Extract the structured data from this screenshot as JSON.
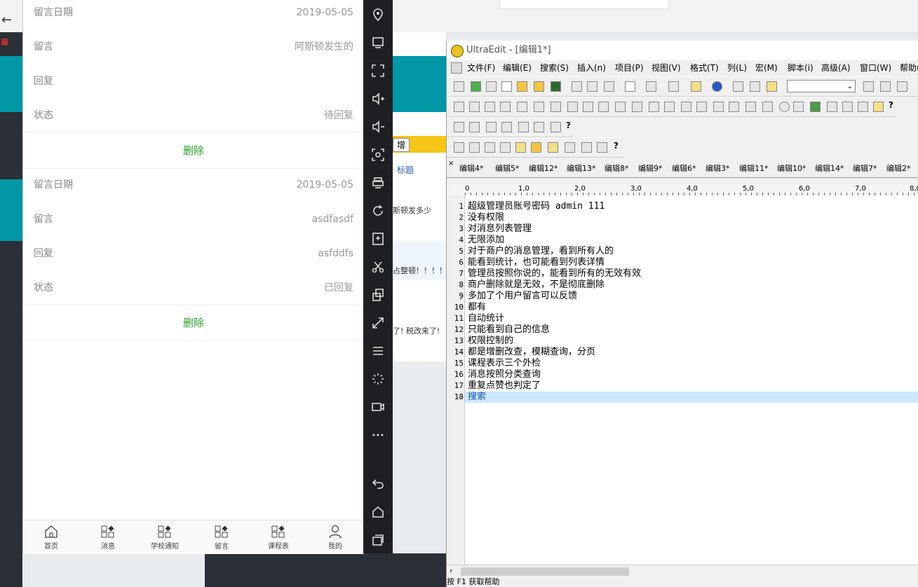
{
  "phone": {
    "cards": [
      {
        "rows": [
          {
            "label": "留言日期",
            "value": "2019-05-05"
          },
          {
            "label": "留言",
            "value": "阿斯顿发生的"
          },
          {
            "label": "回复",
            "value": ""
          },
          {
            "label": "状态",
            "value": "待回复"
          }
        ],
        "delete_label": "删除"
      },
      {
        "rows": [
          {
            "label": "留言日期",
            "value": "2019-05-05"
          },
          {
            "label": "留言",
            "value": "asdfasdf"
          },
          {
            "label": "回复",
            "value": "asfddfs"
          },
          {
            "label": "状态",
            "value": "已回复"
          }
        ],
        "delete_label": "删除"
      }
    ],
    "tabbar": [
      {
        "label": "首页",
        "icon": "home-icon"
      },
      {
        "label": "消息",
        "icon": "grid-icon"
      },
      {
        "label": "学校通知",
        "icon": "grid-icon"
      },
      {
        "label": "留言",
        "icon": "grid-icon"
      },
      {
        "label": "课程表",
        "icon": "grid-icon"
      },
      {
        "label": "我的",
        "icon": "user-icon"
      }
    ]
  },
  "background_page": {
    "add_button": "增",
    "column_header": "标题",
    "row_texts": [
      "斯顿发多少",
      "占整顿！！！！",
      "了! 税改来了!"
    ]
  },
  "emulator_sidebar": {
    "icons": [
      "location-icon",
      "screen-icon",
      "fullscreen-icon",
      "volume-up-icon",
      "volume-down-icon",
      "screenshot-icon",
      "printer-icon",
      "rotate-icon",
      "apk-install-icon",
      "scissors-icon",
      "multi-window-icon",
      "resize-icon",
      "menu-icon",
      "loading-icon",
      "video-icon",
      "more-icon",
      "back-icon",
      "home-icon",
      "recents-icon"
    ]
  },
  "ultraedit": {
    "title": "UltraEdit - [编辑1*]",
    "menu": [
      "文件(F)",
      "编辑(E)",
      "搜索(S)",
      "插入(n)",
      "项目(P)",
      "视图(V)",
      "格式(T)",
      "列(L)",
      "宏(M)",
      "脚本(i)",
      "高级(A)",
      "窗口(W)",
      "帮助("
    ],
    "file_tabs": [
      "编辑4*",
      "编辑5*",
      "编辑12*",
      "编辑13*",
      "编辑8*",
      "编辑9*",
      "编辑6*",
      "编辑3*",
      "编辑11*",
      "编辑10*",
      "编辑14*",
      "编辑7*",
      "编辑2*"
    ],
    "ruler_labels": [
      "0",
      "1,0",
      "2,0",
      "3,0",
      "4,0",
      "5,0",
      "6,0",
      "7,0",
      "8,0"
    ],
    "lines": [
      "超级管理员账号密码 admin 111",
      "没有权限",
      "对消息列表管理",
      "无限添加",
      "对于商户的消息管理，看到所有人的",
      "能看到统计，也可能看到列表详情",
      "管理员按照你说的，能看到所有的无效有效",
      "商户删除就是无效，不是彻底删除",
      "多加了个用户留言可以反馈",
      "都有",
      "自动统计",
      "只能看到自己的信息",
      "权限控制的",
      "都是增删改查，模糊查询，分页",
      "课程表示三个外检",
      "消息按照分类查询",
      "重复点赞也判定了",
      "搜索"
    ],
    "current_line": 18,
    "status": "按 F1 获取帮助"
  }
}
